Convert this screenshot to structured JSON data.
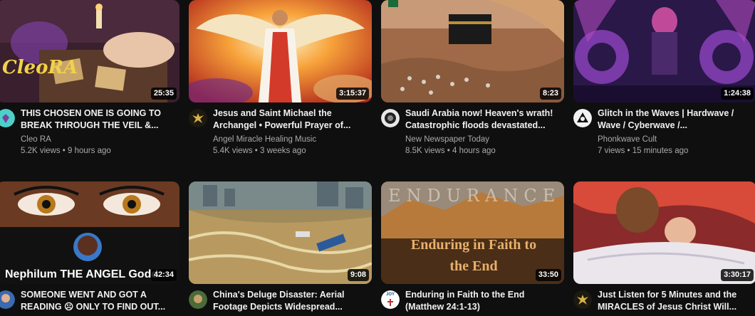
{
  "videos": [
    {
      "title": "THIS CHOSEN ONE IS GOING TO BREAK THROUGH THE VEIL &...",
      "channel": "Cleo RA",
      "views": "5.2K views",
      "age": "9 hours ago",
      "duration": "25:35",
      "thumb_text": "CleoRA"
    },
    {
      "title": "Jesus and Saint Michael the Archangel • Powerful Prayer of...",
      "channel": "Angel Miracle Healing Music",
      "views": "5.4K views",
      "age": "3 weeks ago",
      "duration": "3:15:37"
    },
    {
      "title": "Saudi Arabia now! Heaven's wrath! Catastrophic floods devastated...",
      "channel": "New Newspaper Today",
      "views": "8.5K views",
      "age": "4 hours ago",
      "duration": "8:23"
    },
    {
      "title": "Glitch in the Waves | Hardwave / Wave / Cyberwave /...",
      "channel": "Phonkwave Cult",
      "views": "7 views",
      "age": "15 minutes ago",
      "duration": "1:24:38"
    },
    {
      "title": "SOMEONE WENT AND GOT A READING ☹ ONLY TO FIND OUT...",
      "channel": "",
      "views": "",
      "age": "",
      "duration": "42:34",
      "thumb_text": "Nephilum THE ANGEL Godd"
    },
    {
      "title": "China's Deluge Disaster: Aerial Footage Depicts Widespread...",
      "channel": "",
      "views": "",
      "age": "",
      "duration": "9:08"
    },
    {
      "title": "Enduring in Faith to the End (Matthew 24:1-13)",
      "channel": "",
      "views": "",
      "age": "",
      "duration": "33:50",
      "thumb_text": "Enduring in Faith to the End",
      "thumb_banner": "ENDURANCE",
      "avatar_text": "JOY"
    },
    {
      "title": "Just Listen for 5 Minutes and the MIRACLES of Jesus Christ Will...",
      "channel": "",
      "views": "",
      "age": "",
      "duration": "3:30:17"
    }
  ]
}
